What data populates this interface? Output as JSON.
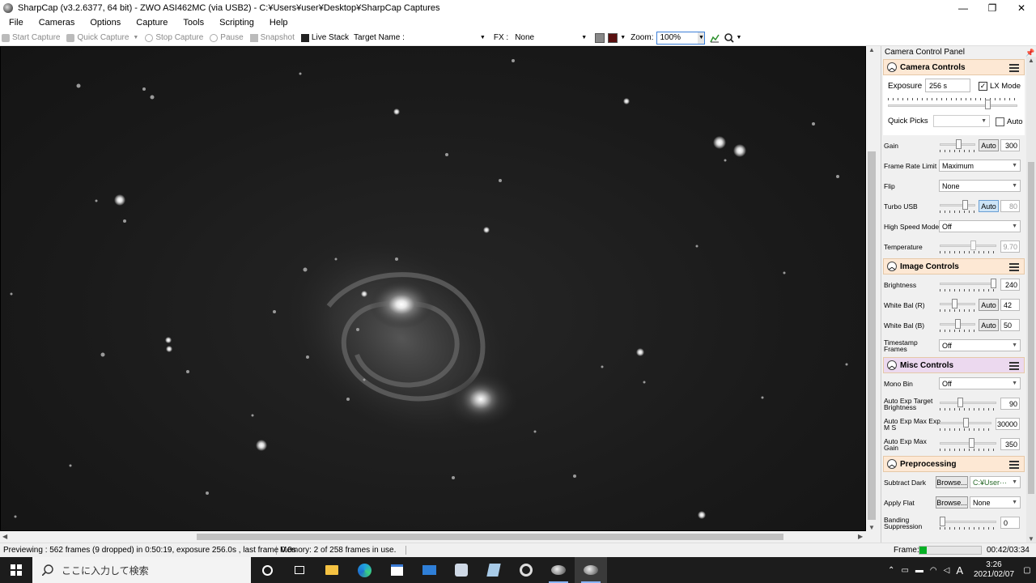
{
  "window": {
    "title": "SharpCap (v3.2.6377, 64 bit) - ZWO ASI462MC (via USB2) - C:¥Users¥user¥Desktop¥SharpCap Captures",
    "minimize": "—",
    "maximize": "❐",
    "close": "✕"
  },
  "menu": [
    "File",
    "Cameras",
    "Options",
    "Capture",
    "Tools",
    "Scripting",
    "Help"
  ],
  "toolbar": {
    "start_capture": "Start Capture",
    "quick_capture": "Quick Capture",
    "stop_capture": "Stop Capture",
    "pause": "Pause",
    "snapshot": "Snapshot",
    "live_stack": "Live Stack",
    "target_name_label": "Target Name :",
    "target_name_value": "",
    "fx_label": "FX :",
    "fx_value": "None",
    "zoom_label": "Zoom:",
    "zoom_value": "100%"
  },
  "panel": {
    "title": "Camera Control Panel",
    "camera_controls": {
      "heading": "Camera Controls",
      "exposure_label": "Exposure",
      "exposure_value": "256 s",
      "lx_mode_label": "LX Mode",
      "lx_mode_checked": true,
      "quick_picks_label": "Quick Picks",
      "quick_picks_value": "",
      "auto_label": "Auto",
      "gain_label": "Gain",
      "gain_auto": "Auto",
      "gain_value": "300",
      "frame_rate_label": "Frame Rate Limit",
      "frame_rate_value": "Maximum",
      "flip_label": "Flip",
      "flip_value": "None",
      "turbo_usb_label": "Turbo USB",
      "turbo_usb_auto": "Auto",
      "turbo_usb_value": "80",
      "high_speed_label": "High Speed Mode",
      "high_speed_value": "Off",
      "temperature_label": "Temperature",
      "temperature_value": "9.70"
    },
    "image_controls": {
      "heading": "Image Controls",
      "brightness_label": "Brightness",
      "brightness_value": "240",
      "wb_r_label": "White Bal (R)",
      "wb_r_auto": "Auto",
      "wb_r_value": "42",
      "wb_b_label": "White Bal (B)",
      "wb_b_auto": "Auto",
      "wb_b_value": "50",
      "timestamp_label": "Timestamp Frames",
      "timestamp_value": "Off"
    },
    "misc_controls": {
      "heading": "Misc Controls",
      "mono_bin_label": "Mono Bin",
      "mono_bin_value": "Off",
      "ae_target_label": "Auto Exp Target Brightness",
      "ae_target_value": "90",
      "ae_maxexp_label": "Auto Exp Max Exp M S",
      "ae_maxexp_value": "30000",
      "ae_maxgain_label": "Auto Exp Max Gain",
      "ae_maxgain_value": "350"
    },
    "preprocessing": {
      "heading": "Preprocessing",
      "subtract_dark_label": "Subtract Dark",
      "browse1": "Browse...",
      "subtract_dark_value": "C:¥User···",
      "apply_flat_label": "Apply Flat",
      "browse2": "Browse...",
      "apply_flat_value": "None",
      "banding_label": "Banding Suppression",
      "banding_value": "0"
    }
  },
  "status": {
    "preview": "Previewing : 562 frames (9 dropped) in 0:50:19, exposure 256.0s , last frame 0.0s",
    "memory": "Memory: 2 of 258 frames in use.",
    "frame_label": "Frame:",
    "frame_progress": 0.12,
    "frame_time": "00:42/03:34"
  },
  "taskbar": {
    "search_placeholder": "ここに入力して検索",
    "time": "3:26",
    "date": "2021/02/07",
    "ime": "A"
  },
  "colors": {
    "camera_header": "#fde8d4",
    "image_header": "#fde8d4",
    "misc_header": "#ecd9ef",
    "pre_header": "#fde8d4",
    "frame_bar": "#06b025"
  }
}
